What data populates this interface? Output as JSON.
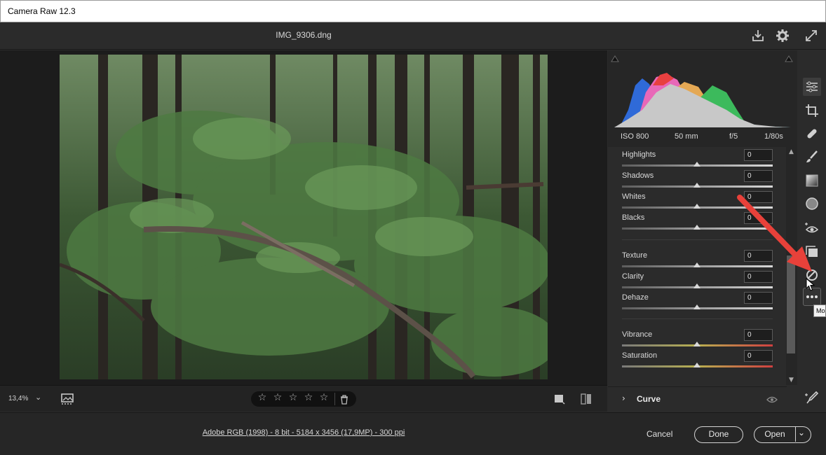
{
  "window": {
    "title": "Camera Raw 12.3"
  },
  "header": {
    "filename": "IMG_9306.dng",
    "icons": [
      "save-icon",
      "gear-icon",
      "fullscreen-icon"
    ]
  },
  "viewer": {
    "zoom": "13,4%",
    "zoom_caret": "⌄",
    "rating_stars": 5
  },
  "histogram": {
    "iso": "ISO 800",
    "focal": "50 mm",
    "aperture": "f/5",
    "shutter": "1/80s"
  },
  "sliders": {
    "highlights": {
      "label": "Highlights",
      "value": "0"
    },
    "shadows": {
      "label": "Shadows",
      "value": "0"
    },
    "whites": {
      "label": "Whites",
      "value": "0"
    },
    "blacks": {
      "label": "Blacks",
      "value": "0"
    },
    "texture": {
      "label": "Texture",
      "value": "0"
    },
    "clarity": {
      "label": "Clarity",
      "value": "0"
    },
    "dehaze": {
      "label": "Dehaze",
      "value": "0"
    },
    "vibrance": {
      "label": "Vibrance",
      "value": "0"
    },
    "saturation": {
      "label": "Saturation",
      "value": "0"
    }
  },
  "sections": {
    "curve": "Curve"
  },
  "footer": {
    "info": "Adobe RGB (1998) - 8 bit - 5184 x 3456 (17,9MP) - 300 ppi",
    "cancel": "Cancel",
    "done": "Done",
    "open": "Open"
  },
  "tooltip": {
    "text": "Mo"
  },
  "colors": {
    "arrow": "#e8413a",
    "panel": "#2b2b2b",
    "background": "#1c1c1c"
  }
}
